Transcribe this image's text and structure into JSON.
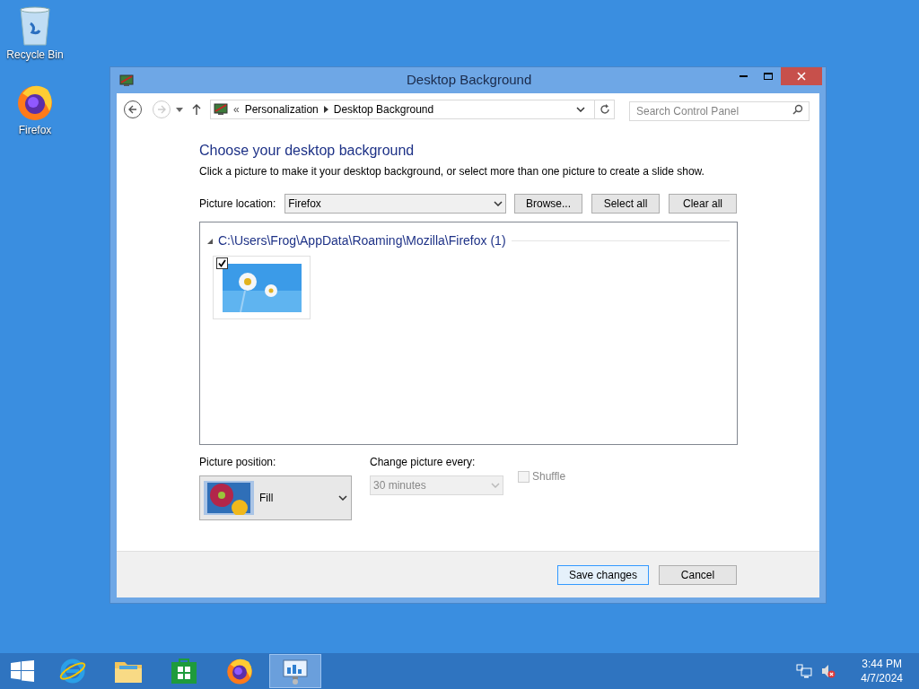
{
  "desktop_icons": [
    {
      "label": "Recycle Bin",
      "kind": "bin"
    },
    {
      "label": "Firefox",
      "kind": "firefox"
    }
  ],
  "window": {
    "title": "Desktop Background"
  },
  "address_bar": {
    "forward_disabled": true,
    "overflow": "«",
    "breadcrumb": [
      "Personalization",
      "Desktop Background"
    ]
  },
  "search": {
    "placeholder": "Search Control Panel"
  },
  "heading": "Choose your desktop background",
  "description": "Click a picture to make it your desktop background, or select more than one picture to create a slide show.",
  "picture_location": {
    "label": "Picture location:",
    "value": "Firefox"
  },
  "location_buttons": [
    "Browse...",
    "Select all",
    "Clear all"
  ],
  "gallery": {
    "group": "C:\\Users\\Frog\\AppData\\Roaming\\Mozilla\\Firefox (1)",
    "expanded": true,
    "pictures": [
      {
        "kind": "picture",
        "checked": true
      }
    ]
  },
  "picture_position": {
    "label": "Picture position:",
    "value": "Fill"
  },
  "change_picture": {
    "label": "Change picture every:",
    "value": "30 minutes",
    "disabled": true
  },
  "shuffle": {
    "label": "Shuffle",
    "checked": false,
    "disabled": true
  },
  "footer_buttons": [
    {
      "label": "Save changes",
      "default": true
    },
    {
      "label": "Cancel",
      "default": false
    }
  ],
  "taskbar": {
    "apps": [
      {
        "kind": "ie",
        "selected": false
      },
      {
        "kind": "explorer",
        "selected": false
      },
      {
        "kind": "store",
        "selected": false
      },
      {
        "kind": "firefox",
        "selected": false
      },
      {
        "kind": "control-panel",
        "selected": true
      }
    ]
  },
  "clock": {
    "time": "3:44 PM",
    "date": "4/7/2024"
  }
}
